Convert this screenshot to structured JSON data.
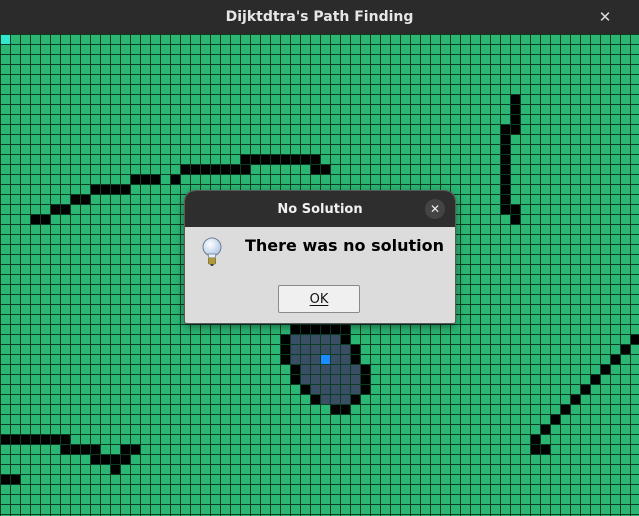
{
  "window": {
    "title": "Dijktdtra's Path Finding",
    "close_glyph": "✕"
  },
  "grid": {
    "cols": 64,
    "rows": 48,
    "colors": {
      "empty": "#2bb673",
      "line": "#0a3d23",
      "wall": "#000000",
      "visited": "#3a4f66",
      "start": "#1a8cff",
      "end": "#33e6d0"
    },
    "start_cell": [
      32,
      32
    ],
    "end_cell": [
      0,
      0
    ],
    "walls": [
      [
        51,
        6
      ],
      [
        51,
        7
      ],
      [
        51,
        8
      ],
      [
        50,
        9
      ],
      [
        51,
        9
      ],
      [
        50,
        10
      ],
      [
        50,
        11
      ],
      [
        50,
        12
      ],
      [
        50,
        13
      ],
      [
        50,
        14
      ],
      [
        50,
        15
      ],
      [
        50,
        16
      ],
      [
        50,
        17
      ],
      [
        51,
        17
      ],
      [
        51,
        18
      ],
      [
        24,
        12
      ],
      [
        25,
        12
      ],
      [
        26,
        12
      ],
      [
        27,
        12
      ],
      [
        28,
        12
      ],
      [
        29,
        12
      ],
      [
        30,
        12
      ],
      [
        31,
        12
      ],
      [
        18,
        13
      ],
      [
        19,
        13
      ],
      [
        20,
        13
      ],
      [
        21,
        13
      ],
      [
        22,
        13
      ],
      [
        23,
        13
      ],
      [
        24,
        13
      ],
      [
        31,
        13
      ],
      [
        32,
        13
      ],
      [
        13,
        14
      ],
      [
        14,
        14
      ],
      [
        15,
        14
      ],
      [
        17,
        14
      ],
      [
        9,
        15
      ],
      [
        10,
        15
      ],
      [
        11,
        15
      ],
      [
        12,
        15
      ],
      [
        7,
        16
      ],
      [
        8,
        16
      ],
      [
        5,
        17
      ],
      [
        6,
        17
      ],
      [
        3,
        18
      ],
      [
        4,
        18
      ],
      [
        29,
        29
      ],
      [
        30,
        29
      ],
      [
        31,
        29
      ],
      [
        32,
        29
      ],
      [
        33,
        29
      ],
      [
        34,
        29
      ],
      [
        28,
        30
      ],
      [
        34,
        30
      ],
      [
        28,
        31
      ],
      [
        35,
        31
      ],
      [
        28,
        32
      ],
      [
        35,
        32
      ],
      [
        29,
        33
      ],
      [
        36,
        33
      ],
      [
        29,
        34
      ],
      [
        36,
        34
      ],
      [
        30,
        35
      ],
      [
        36,
        35
      ],
      [
        31,
        36
      ],
      [
        35,
        36
      ],
      [
        33,
        37
      ],
      [
        34,
        37
      ],
      [
        63,
        30
      ],
      [
        62,
        31
      ],
      [
        61,
        32
      ],
      [
        60,
        33
      ],
      [
        59,
        34
      ],
      [
        58,
        35
      ],
      [
        57,
        36
      ],
      [
        56,
        37
      ],
      [
        55,
        38
      ],
      [
        54,
        39
      ],
      [
        53,
        40
      ],
      [
        53,
        41
      ],
      [
        54,
        41
      ],
      [
        0,
        40
      ],
      [
        1,
        40
      ],
      [
        2,
        40
      ],
      [
        3,
        40
      ],
      [
        4,
        40
      ],
      [
        5,
        40
      ],
      [
        6,
        40
      ],
      [
        6,
        41
      ],
      [
        7,
        41
      ],
      [
        8,
        41
      ],
      [
        9,
        41
      ],
      [
        12,
        41
      ],
      [
        13,
        41
      ],
      [
        9,
        42
      ],
      [
        10,
        42
      ],
      [
        11,
        42
      ],
      [
        12,
        42
      ],
      [
        11,
        43
      ],
      [
        0,
        44
      ],
      [
        1,
        44
      ]
    ],
    "visited": [
      [
        29,
        30
      ],
      [
        30,
        30
      ],
      [
        31,
        30
      ],
      [
        32,
        30
      ],
      [
        33,
        30
      ],
      [
        29,
        31
      ],
      [
        30,
        31
      ],
      [
        31,
        31
      ],
      [
        32,
        31
      ],
      [
        33,
        31
      ],
      [
        34,
        31
      ],
      [
        29,
        32
      ],
      [
        30,
        32
      ],
      [
        31,
        32
      ],
      [
        33,
        32
      ],
      [
        34,
        32
      ],
      [
        30,
        33
      ],
      [
        31,
        33
      ],
      [
        32,
        33
      ],
      [
        33,
        33
      ],
      [
        34,
        33
      ],
      [
        35,
        33
      ],
      [
        30,
        34
      ],
      [
        31,
        34
      ],
      [
        32,
        34
      ],
      [
        33,
        34
      ],
      [
        34,
        34
      ],
      [
        35,
        34
      ],
      [
        31,
        35
      ],
      [
        32,
        35
      ],
      [
        33,
        35
      ],
      [
        34,
        35
      ],
      [
        35,
        35
      ],
      [
        32,
        36
      ],
      [
        33,
        36
      ],
      [
        34,
        36
      ]
    ]
  },
  "dialog": {
    "title": "No Solution",
    "close_glyph": "✕",
    "message": "There was no solution",
    "ok_label": "OK",
    "icon": "lightbulb-icon"
  }
}
